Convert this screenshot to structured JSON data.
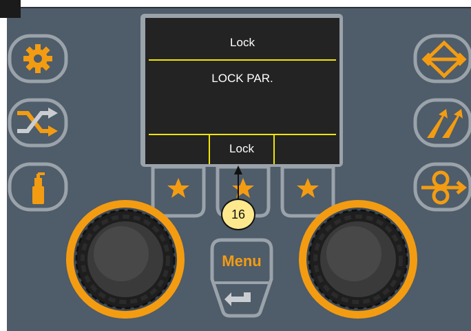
{
  "screen": {
    "title": "Lock",
    "message": "LOCK PAR.",
    "softkey_left": "",
    "softkey_center": "Lock",
    "softkey_right": ""
  },
  "callout": {
    "number": "16"
  },
  "buttons": {
    "menu_label": "Menu"
  },
  "icons": {
    "left": [
      "gear-icon",
      "shuffle-icon",
      "spray-can-icon"
    ],
    "right": [
      "direction-diamond-icon",
      "double-slash-arrows-icon",
      "loop-arrow-icon"
    ],
    "favorites": [
      "star-icon",
      "star-icon",
      "star-icon"
    ],
    "menu_back": "return-arrow-icon"
  },
  "colors": {
    "panel": "#4f5c69",
    "accent": "#f39c12",
    "button_border": "#9aa2aa",
    "screen": "#232323",
    "screen_divider": "#f2e600",
    "callout_fill": "#fde88e"
  }
}
